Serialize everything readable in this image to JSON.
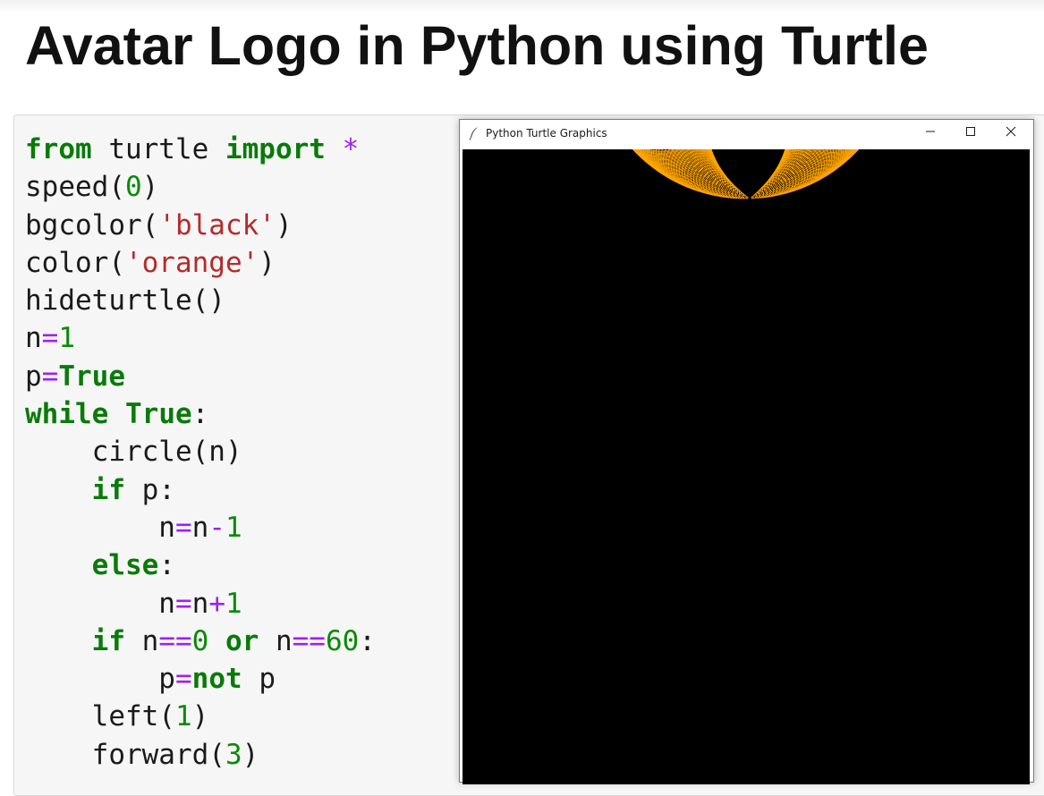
{
  "page": {
    "title": "Avatar Logo in Python using Turtle"
  },
  "code": {
    "language": "python",
    "lines": [
      "from turtle import *",
      "speed(0)",
      "bgcolor('black')",
      "color('orange')",
      "hideturtle()",
      "n=1",
      "p=True",
      "while True:",
      "    circle(n)",
      "    if p:",
      "        n=n-1",
      "    else:",
      "        n=n+1",
      "    if n==0 or n==60:",
      "        p=not p",
      "    left(1)",
      "    forward(3)"
    ]
  },
  "window": {
    "title": "Python Turtle Graphics",
    "minimize_icon": "minimize-icon",
    "maximize_icon": "maximize-icon",
    "close_icon": "close-icon",
    "app_icon": "feather-icon"
  },
  "drawing": {
    "background_color": "#000000",
    "stroke_color": "#ffa500",
    "name": "avatar-logo"
  },
  "colors": {
    "keyword": "#0a7a0a",
    "operator": "#a020f0",
    "number": "#0a8a0a",
    "string": "#b52a2a",
    "code_background": "#f6f6f6"
  }
}
